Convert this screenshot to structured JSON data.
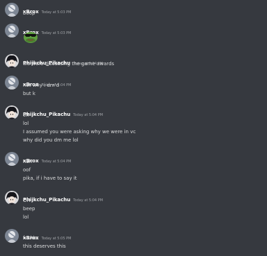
{
  "messages": [
    {
      "author": "xBrox",
      "timestamp": "Today at 5:03 PM",
      "lines": [
        "boop"
      ]
    },
    {
      "author": "xBrox",
      "timestamp": "Today at 5:03 PM",
      "emoji": "pepe-sunglasses-emoji"
    },
    {
      "author": "Phijkchu_Pikachu",
      "timestamp": "Today at 5:04 PM",
      "lines": [
        "we were discussing the game awards"
      ]
    },
    {
      "author": "xBrox",
      "timestamp": "Today at 5:04 PM",
      "lines": [
        "not why i dm'd",
        "but k"
      ]
    },
    {
      "author": "Phijkchu_Pikachu",
      "timestamp": "Today at 5:04 PM",
      "lines": [
        "oh",
        "lol",
        "I assumed you were asking why we were in vc",
        "why did you dm me lol"
      ]
    },
    {
      "author": "xBrox",
      "timestamp": "Today at 5:04 PM",
      "lines": [
        "nah",
        "oof",
        "pika, if i have to say it"
      ]
    },
    {
      "author": "Phijkchu_Pikachu",
      "timestamp": "Today at 5:04 PM",
      "lines": [
        "OH",
        "beep",
        "lol"
      ]
    },
    {
      "author": "xBrox",
      "timestamp": "Today at 5:05 PM",
      "lines": [
        "fuckin",
        "this deserves this"
      ]
    }
  ],
  "colors": {
    "background": "#36393f",
    "text": "#dcddde",
    "username": "#ffffff",
    "timestamp": "#a3a6aa"
  },
  "icons": {
    "xbrox_avatar": "pale-figure-avatar",
    "pika_avatar": "dark-haired-anime-avatar"
  }
}
